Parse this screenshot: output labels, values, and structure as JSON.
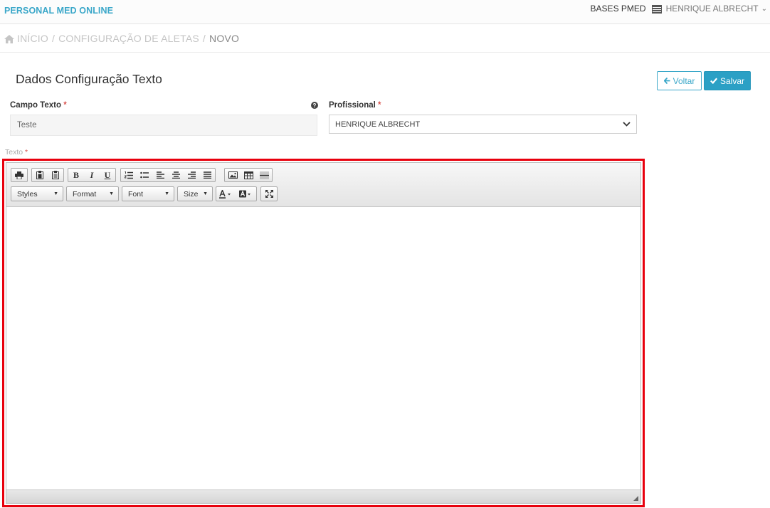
{
  "header": {
    "brand": "PERSONAL MED ONLINE",
    "bases_label": "BASES PMED",
    "user_name": "HENRIQUE ALBRECHT"
  },
  "breadcrumb": {
    "home": "INÍCIO",
    "section": "CONFIGURAÇÃO DE ALETAS",
    "current": "NOVO",
    "separator": "/"
  },
  "form": {
    "title": "Dados Configuração Texto",
    "voltar_label": "Voltar",
    "salvar_label": "Salvar",
    "campo_texto": {
      "label": "Campo Texto",
      "required_mark": "*",
      "value": "Teste"
    },
    "profissional": {
      "label": "Profissional",
      "required_mark": "*",
      "selected": "HENRIQUE ALBRECHT"
    },
    "texto": {
      "label": "Texto",
      "required_mark": "*"
    }
  },
  "editor": {
    "combos": {
      "styles": "Styles",
      "format": "Format",
      "font": "Font",
      "size": "Size"
    },
    "toolbar_icons": [
      "print-icon",
      "paste-icon",
      "paste-text-icon",
      "bold-icon",
      "italic-icon",
      "underline-icon",
      "ordered-list-icon",
      "unordered-list-icon",
      "align-left-icon",
      "align-center-icon",
      "align-right-icon",
      "align-justify-icon",
      "image-icon",
      "table-icon",
      "horizontal-rule-icon",
      "text-color-icon",
      "background-color-icon",
      "maximize-icon"
    ],
    "colors": {
      "highlight_border": "#e8000d",
      "accent": "#2ba0c5"
    }
  }
}
